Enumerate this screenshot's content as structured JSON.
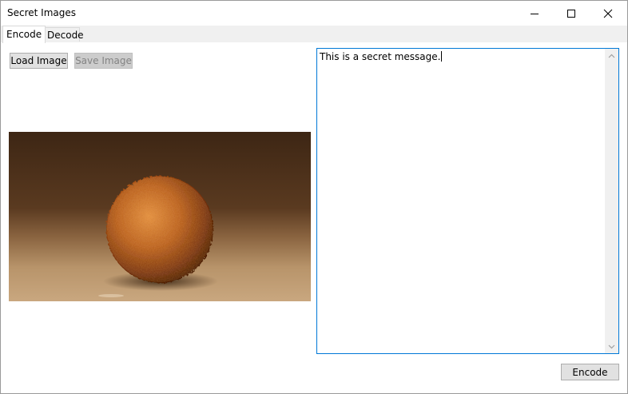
{
  "window": {
    "title": "Secret Images",
    "minimize_icon": "minimize-icon",
    "maximize_icon": "maximize-icon",
    "close_icon": "close-icon"
  },
  "tabs": [
    {
      "label": "Encode",
      "active": true
    },
    {
      "label": "Decode",
      "active": false
    }
  ],
  "encode": {
    "load_image_label": "Load Image",
    "save_image_label": "Save Image",
    "message_text": "This is a secret message.",
    "encode_button_label": "Encode"
  },
  "colors": {
    "accent": "#0078d7",
    "button_bg": "#e1e1e1",
    "disabled_button_bg": "#cccccc",
    "photo_background_top": "#3d2614",
    "photo_background_bottom": "#c9a77f",
    "ball_color": "#b85c1a"
  }
}
